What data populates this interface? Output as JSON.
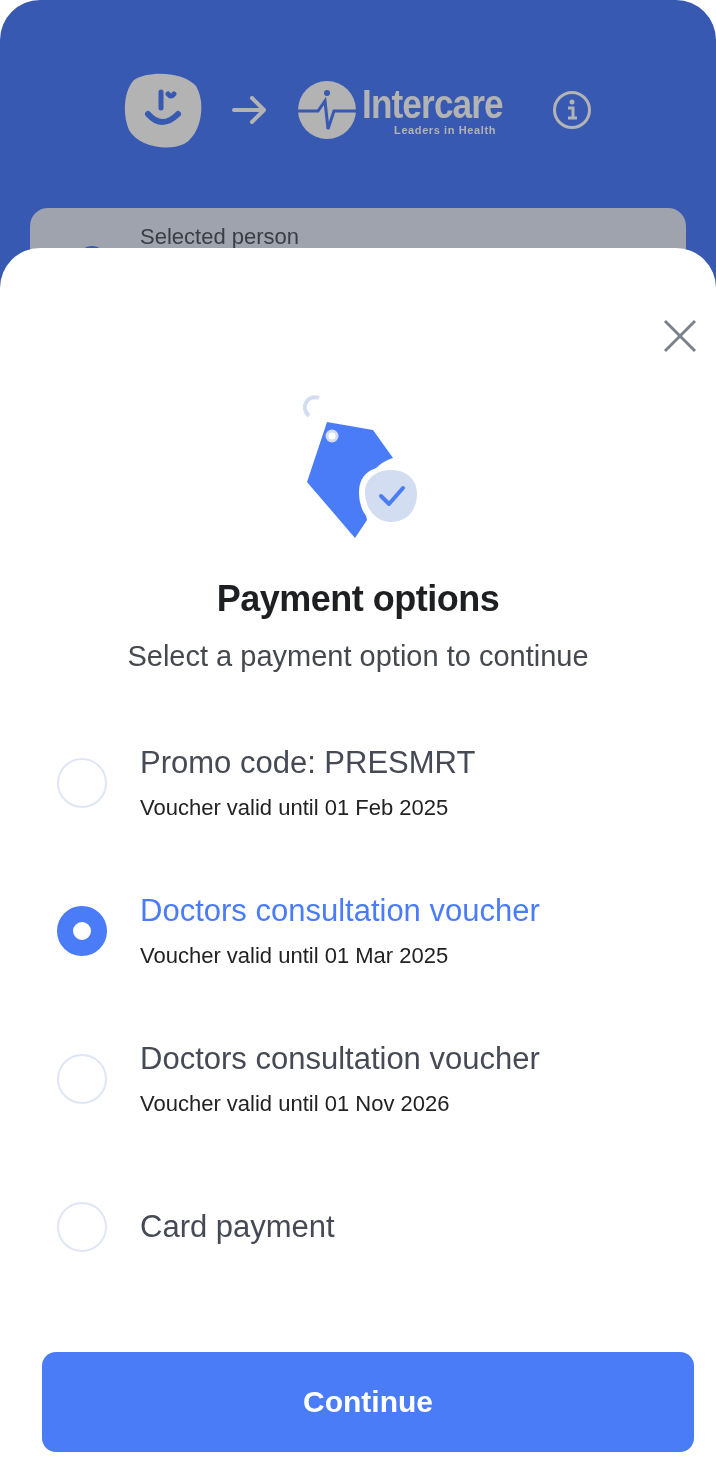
{
  "header": {
    "brand_name": "Intercare",
    "brand_tagline": "Leaders in Health",
    "card_label": "Selected person"
  },
  "sheet": {
    "title": "Payment options",
    "subtitle": "Select a payment option to continue",
    "options": [
      {
        "title": "Promo code: PRESMRT",
        "subtitle": "Voucher valid until 01 Feb 2025",
        "selected": false
      },
      {
        "title": "Doctors consultation voucher",
        "subtitle": "Voucher valid until  01 Mar 2025",
        "selected": true
      },
      {
        "title": "Doctors consultation voucher",
        "subtitle": "Voucher valid until  01 Nov 2026",
        "selected": false
      },
      {
        "title": "Card payment",
        "selected": false
      }
    ],
    "button": "Continue"
  }
}
